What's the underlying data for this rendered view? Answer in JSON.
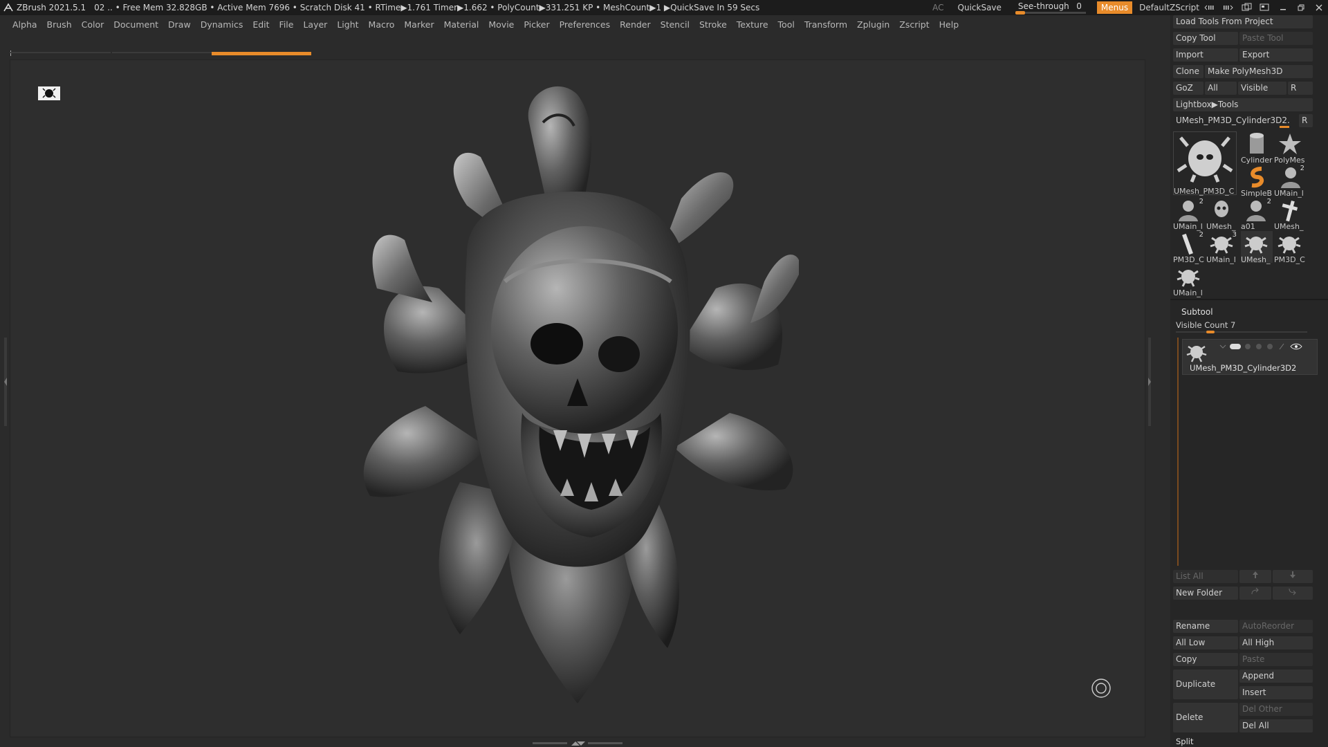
{
  "titlebar": {
    "app": "ZBrush 2021.5.1",
    "info": "02  .. • Free Mem 32.828GB • Active Mem 7696 • Scratch Disk 41 •  RTime▶1.761 Timer▶1.662 • PolyCount▶331.251 KP  • MeshCount▶1  ▶QuickSave In 59 Secs",
    "ac": "AC",
    "quicksave": "QuickSave",
    "seethrough_label": "See-through",
    "seethrough_value": "0",
    "menus": "Menus",
    "script": "DefaultZScript"
  },
  "menubar": {
    "items": [
      "Alpha",
      "Brush",
      "Color",
      "Document",
      "Draw",
      "Dynamics",
      "Edit",
      "File",
      "Layer",
      "Light",
      "Macro",
      "Marker",
      "Material",
      "Movie",
      "Picker",
      "Preferences",
      "Render",
      "Stencil",
      "Stroke",
      "Texture",
      "Tool",
      "Transform",
      "Zplugin",
      "Zscript",
      "Help"
    ]
  },
  "tool_panel": {
    "load_tools": "Load Tools From Project",
    "copy_tool": "Copy Tool",
    "paste_tool": "Paste Tool",
    "import": "Import",
    "export": "Export",
    "clone": "Clone",
    "make_polymesh": "Make PolyMesh3D",
    "goz": "GoZ",
    "all": "All",
    "visible": "Visible",
    "r": "R",
    "lightbox_tools": "Lightbox▶Tools",
    "current_tool": "UMesh_PM3D_Cylinder3D2.",
    "current_tool_r": "R",
    "tiles": [
      {
        "label": "UMesh_PM3D_C",
        "count": ""
      },
      {
        "label": "Cylinder",
        "count": ""
      },
      {
        "label": "PolyMes",
        "count": ""
      },
      {
        "label": "SimpleB",
        "count": ""
      },
      {
        "label": "UMain_l",
        "count": "2"
      },
      {
        "label": "UMain_l",
        "count": "2"
      },
      {
        "label": "UMesh_",
        "count": ""
      },
      {
        "label": "a01",
        "count": "2"
      },
      {
        "label": "UMesh_",
        "count": ""
      },
      {
        "label": "PM3D_C",
        "count": "2"
      },
      {
        "label": "UMain_l",
        "count": "3"
      },
      {
        "label": "UMesh_",
        "count": ""
      },
      {
        "label": "PM3D_C",
        "count": ""
      },
      {
        "label": "UMain_l",
        "count": ""
      }
    ]
  },
  "subtool": {
    "title": "Subtool",
    "visible_count": "Visible Count 7",
    "item_name": "UMesh_PM3D_Cylinder3D2",
    "list_all": "List All",
    "new_folder": "New Folder",
    "rename": "Rename",
    "autoreorder": "AutoReorder",
    "all_low": "All Low",
    "all_high": "All High",
    "copy": "Copy",
    "paste": "Paste",
    "duplicate": "Duplicate",
    "append": "Append",
    "insert": "Insert",
    "delete": "Delete",
    "del_other": "Del Other",
    "del_all": "Del All",
    "split": "Split"
  },
  "colors": {
    "accent": "#e88b2a",
    "bg": "#2b2b2b",
    "titlebar": "#1c1c1c"
  }
}
